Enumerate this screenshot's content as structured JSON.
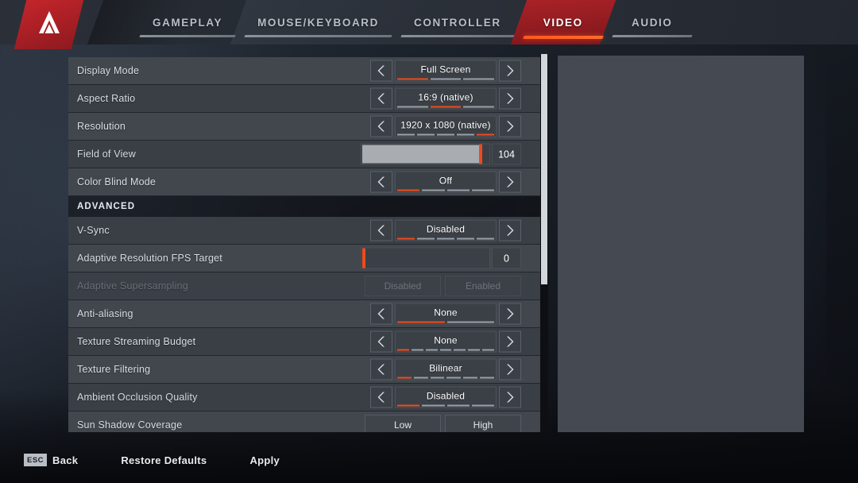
{
  "header": {
    "logo_icon": "apex-logo-icon",
    "tabs": [
      {
        "label": "GAMEPLAY",
        "active": false
      },
      {
        "label": "MOUSE/KEYBOARD",
        "active": false
      },
      {
        "label": "CONTROLLER",
        "active": false
      },
      {
        "label": "VIDEO",
        "active": true
      },
      {
        "label": "AUDIO",
        "active": false
      }
    ]
  },
  "settings": {
    "rows": [
      {
        "type": "selector",
        "label": "Display Mode",
        "value": "Full Screen",
        "segments": 3,
        "active_segment": 1
      },
      {
        "type": "selector",
        "label": "Aspect Ratio",
        "value": "16:9 (native)",
        "segments": 3,
        "active_segment": 2
      },
      {
        "type": "selector",
        "label": "Resolution",
        "value": "1920 x 1080 (native)",
        "segments": 5,
        "active_segment": 5
      },
      {
        "type": "slider",
        "label": "Field of View",
        "value": "104",
        "fill_percent": 93
      },
      {
        "type": "selector",
        "label": "Color Blind Mode",
        "value": "Off",
        "segments": 4,
        "active_segment": 1
      },
      {
        "type": "section",
        "label": "ADVANCED"
      },
      {
        "type": "selector",
        "label": "V-Sync",
        "value": "Disabled",
        "segments": 5,
        "active_segment": 1
      },
      {
        "type": "slider",
        "label": "Adaptive Resolution FPS Target",
        "value": "0",
        "fill_percent": 0
      },
      {
        "type": "toggle",
        "label": "Adaptive Supersampling",
        "disabled": true,
        "options": [
          "Disabled",
          "Enabled"
        ]
      },
      {
        "type": "selector",
        "label": "Anti-aliasing",
        "value": "None",
        "segments": 2,
        "active_segment": 1
      },
      {
        "type": "selector",
        "label": "Texture Streaming Budget",
        "value": "None",
        "segments": 7,
        "active_segment": 1
      },
      {
        "type": "selector",
        "label": "Texture Filtering",
        "value": "Bilinear",
        "segments": 6,
        "active_segment": 1
      },
      {
        "type": "selector",
        "label": "Ambient Occlusion Quality",
        "value": "Disabled",
        "segments": 4,
        "active_segment": 1
      },
      {
        "type": "toggle",
        "label": "Sun Shadow Coverage",
        "disabled": false,
        "options": [
          "Low",
          "High"
        ]
      }
    ],
    "scrollbar": {
      "thumb_top_percent": 0,
      "thumb_height_percent": 61
    }
  },
  "footer": {
    "items": [
      {
        "key": "ESC",
        "label": "Back"
      },
      {
        "key": "",
        "label": "Restore Defaults"
      },
      {
        "key": "",
        "label": "Apply"
      }
    ]
  },
  "colors": {
    "accent": "#f24b18",
    "accent_tab": "#ff5a1f",
    "brand_red": "#a81f25",
    "row": "#42474e",
    "row_alt": "#3a3f46"
  }
}
